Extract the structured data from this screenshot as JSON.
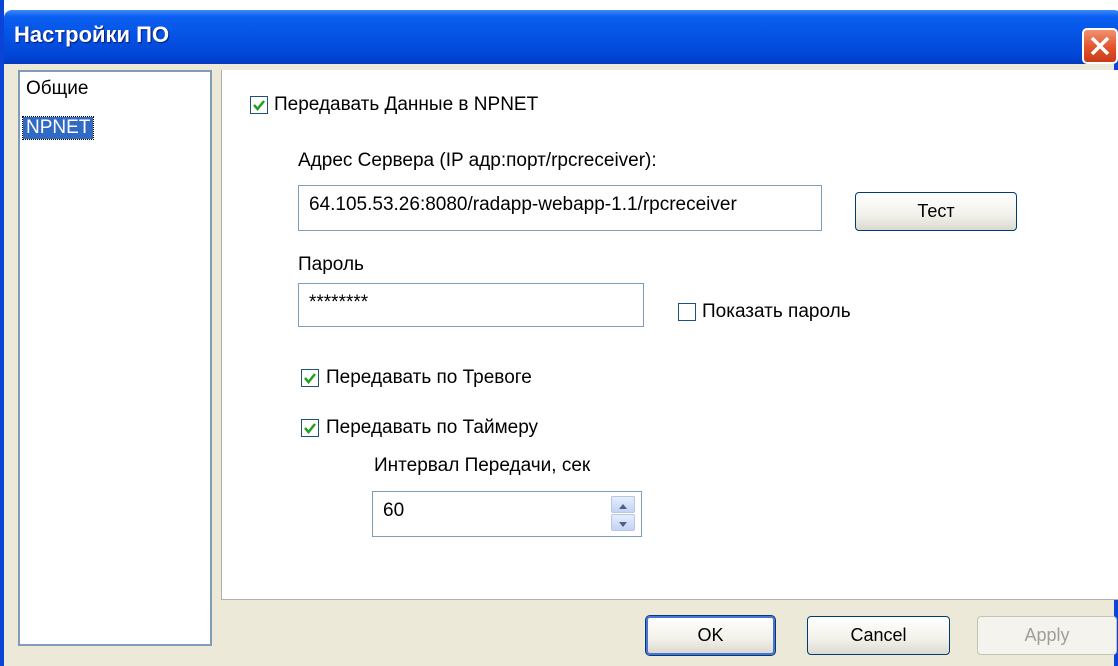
{
  "window": {
    "title": "Настройки ПО"
  },
  "sidebar": {
    "items": [
      {
        "label": "Общие"
      },
      {
        "label": "NPNET"
      }
    ]
  },
  "npnet": {
    "send_data": {
      "label": "Передавать Данные в NPNET",
      "checked": true
    },
    "server": {
      "label": "Адрес Сервера (IP адр:порт/rpcreceiver):",
      "value": "64.105.53.26:8080/radapp-webapp-1.1/rpcreceiver"
    },
    "test_button": "Тест",
    "password": {
      "label": "Пароль",
      "value": "********"
    },
    "show_password": {
      "label": "Показать пароль",
      "checked": false
    },
    "on_alarm": {
      "label": "Передавать по Тревоге",
      "checked": true
    },
    "on_timer": {
      "label": "Передавать по Таймеру",
      "checked": true
    },
    "interval": {
      "label": "Интервал Передачи, сек",
      "value": "60"
    }
  },
  "footer": {
    "ok": "OK",
    "cancel": "Cancel",
    "apply": "Apply"
  }
}
